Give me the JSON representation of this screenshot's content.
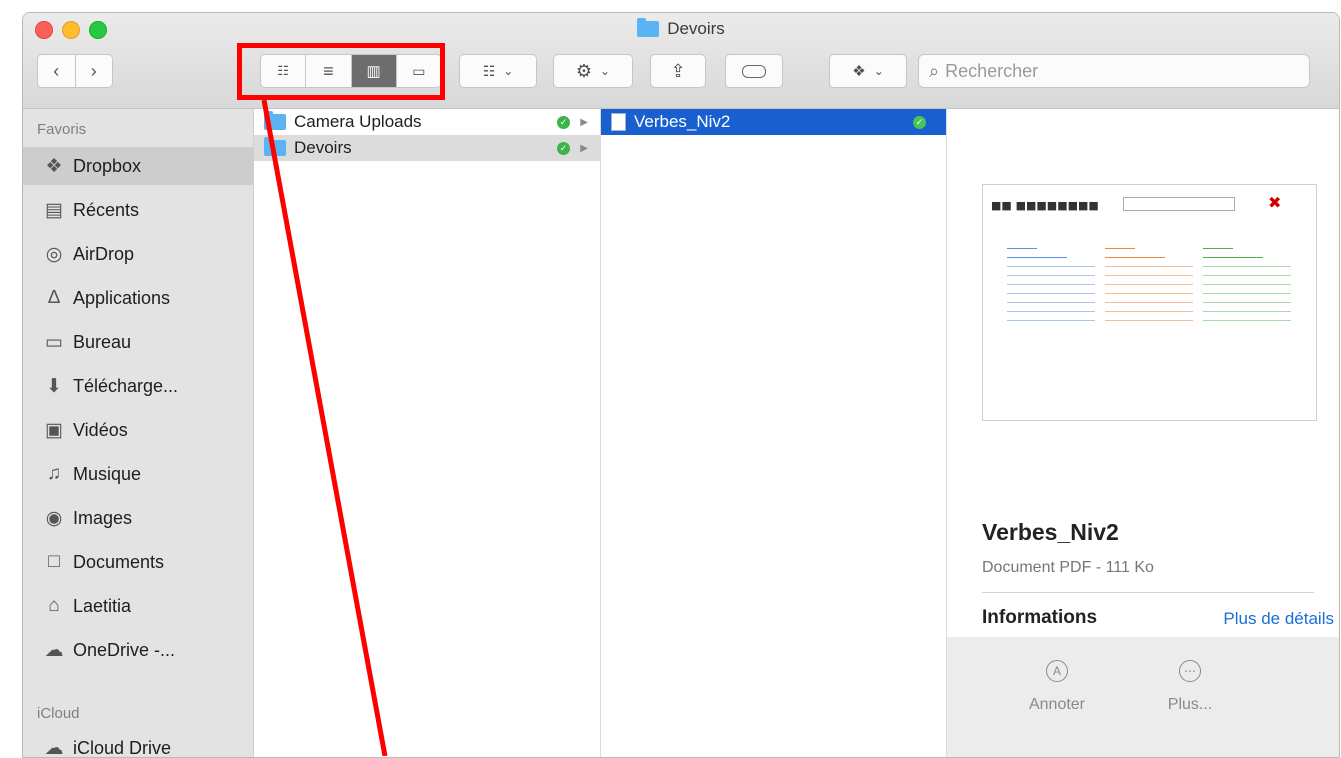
{
  "window": {
    "title": "Devoirs"
  },
  "toolbar": {
    "back_icon": "chevron-left-icon",
    "forward_icon": "chevron-right-icon",
    "view_icons": [
      "icon-view",
      "list-view",
      "column-view",
      "gallery-view"
    ],
    "active_view": "column-view",
    "search_placeholder": "Rechercher"
  },
  "sidebar": {
    "favorites_heading": "Favoris",
    "icloud_heading": "iCloud",
    "items": [
      {
        "label": "Dropbox",
        "icon": "dropbox-icon"
      },
      {
        "label": "Récents",
        "icon": "recents-icon"
      },
      {
        "label": "AirDrop",
        "icon": "airdrop-icon"
      },
      {
        "label": "Applications",
        "icon": "applications-icon"
      },
      {
        "label": "Bureau",
        "icon": "desktop-icon"
      },
      {
        "label": "Télécharge...",
        "icon": "download-icon"
      },
      {
        "label": "Vidéos",
        "icon": "video-icon"
      },
      {
        "label": "Musique",
        "icon": "music-icon"
      },
      {
        "label": "Images",
        "icon": "camera-icon"
      },
      {
        "label": "Documents",
        "icon": "documents-icon"
      },
      {
        "label": "Laetitia",
        "icon": "home-icon"
      },
      {
        "label": "OneDrive -...",
        "icon": "cloud-icon"
      }
    ],
    "icloud_items": [
      {
        "label": "iCloud Drive",
        "icon": "icloud-icon"
      }
    ]
  },
  "column1": [
    {
      "label": "Camera Uploads"
    },
    {
      "label": "Devoirs"
    }
  ],
  "column2": [
    {
      "label": "Verbes_Niv2"
    }
  ],
  "preview": {
    "name": "Verbes_Niv2",
    "meta": "Document PDF - 111 Ko",
    "info_title": "Informations",
    "info_link": "Plus de détails",
    "actions": [
      {
        "label": "Annoter"
      },
      {
        "label": "Plus..."
      }
    ]
  },
  "colors": {
    "annotation": "#ff0000",
    "selection": "#1a5fd0",
    "sync_ok": "#3cb44a"
  }
}
